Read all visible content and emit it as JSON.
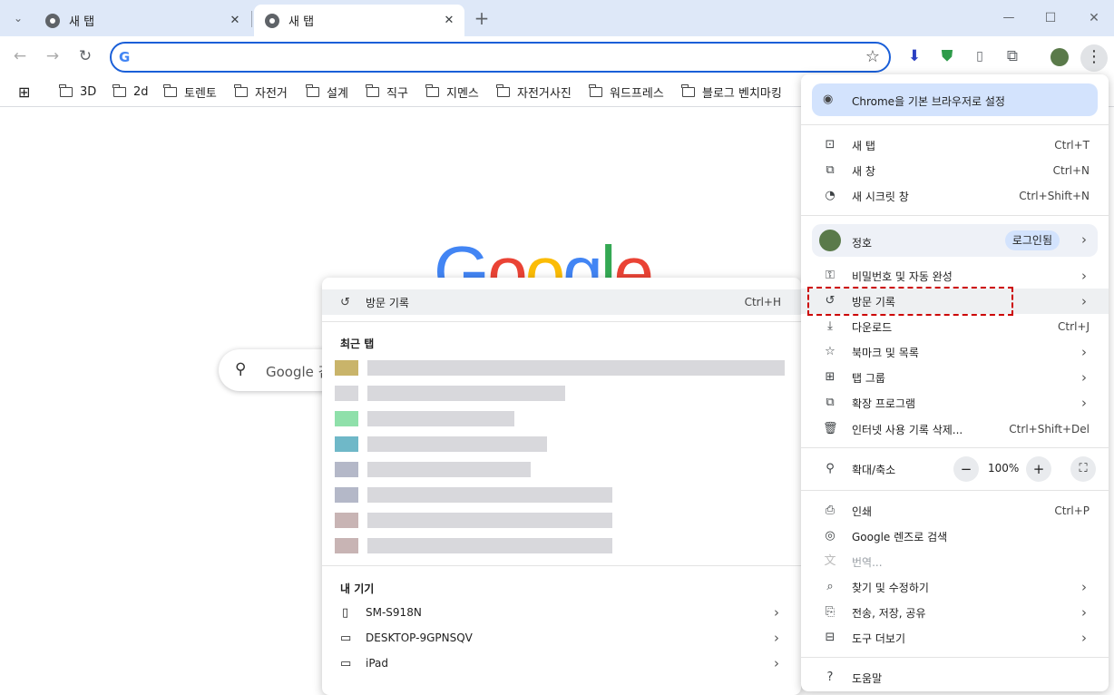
{
  "tabs": [
    {
      "title": "새 탭"
    },
    {
      "title": "새 탭"
    }
  ],
  "window_controls": {
    "minimize": "—",
    "maximize": "☐",
    "close": "✕"
  },
  "toolbar": {
    "omnibox_value": ""
  },
  "bookmarks": [
    {
      "label": "3D"
    },
    {
      "label": "2d"
    },
    {
      "label": "토렌토"
    },
    {
      "label": "자전거"
    },
    {
      "label": "설계"
    },
    {
      "label": "직구"
    },
    {
      "label": "지멘스"
    },
    {
      "label": "자전거사진"
    },
    {
      "label": "워드프레스"
    },
    {
      "label": "블로그 벤치마킹"
    }
  ],
  "page": {
    "logo": "Google",
    "search_placeholder": "Google 검"
  },
  "history_submenu": {
    "history": {
      "label": "방문 기록",
      "shortcut": "Ctrl+H"
    },
    "recent_tabs_heading": "최근 탭",
    "my_devices_heading": "내 기기",
    "devices": [
      {
        "name": "SM-S918N"
      },
      {
        "name": "DESKTOP-9GPNSQV"
      },
      {
        "name": "iPad"
      }
    ]
  },
  "menu": {
    "default_browser": "Chrome을 기본 브라우저로 설정",
    "new_tab": {
      "label": "새 탭",
      "shortcut": "Ctrl+T"
    },
    "new_window": {
      "label": "새 창",
      "shortcut": "Ctrl+N"
    },
    "incognito": {
      "label": "새 시크릿 창",
      "shortcut": "Ctrl+Shift+N"
    },
    "profile": {
      "name": "정호",
      "status": "로그인됨"
    },
    "passwords": {
      "label": "비밀번호 및 자동 완성"
    },
    "history": {
      "label": "방문 기록"
    },
    "downloads": {
      "label": "다운로드",
      "shortcut": "Ctrl+J"
    },
    "bookmarks": {
      "label": "북마크 및 목록"
    },
    "tab_groups": {
      "label": "탭 그룹"
    },
    "extensions": {
      "label": "확장 프로그램"
    },
    "clear_data": {
      "label": "인터넷 사용 기록 삭제...",
      "shortcut": "Ctrl+Shift+Del"
    },
    "zoom": {
      "label": "확대/축소",
      "minus": "−",
      "value": "100%",
      "plus": "+"
    },
    "print": {
      "label": "인쇄",
      "shortcut": "Ctrl+P"
    },
    "lens": {
      "label": "Google 렌즈로 검색"
    },
    "translate": {
      "label": "번역..."
    },
    "find": {
      "label": "찾기 및 수정하기"
    },
    "cast": {
      "label": "전송, 저장, 공유"
    },
    "more_tools": {
      "label": "도구 더보기"
    },
    "help": {
      "label": "도움말"
    }
  },
  "colors": {
    "accent": "#1a5fd8",
    "tabstrip": "#dee8f8",
    "highlight_border": "#cc0000"
  }
}
